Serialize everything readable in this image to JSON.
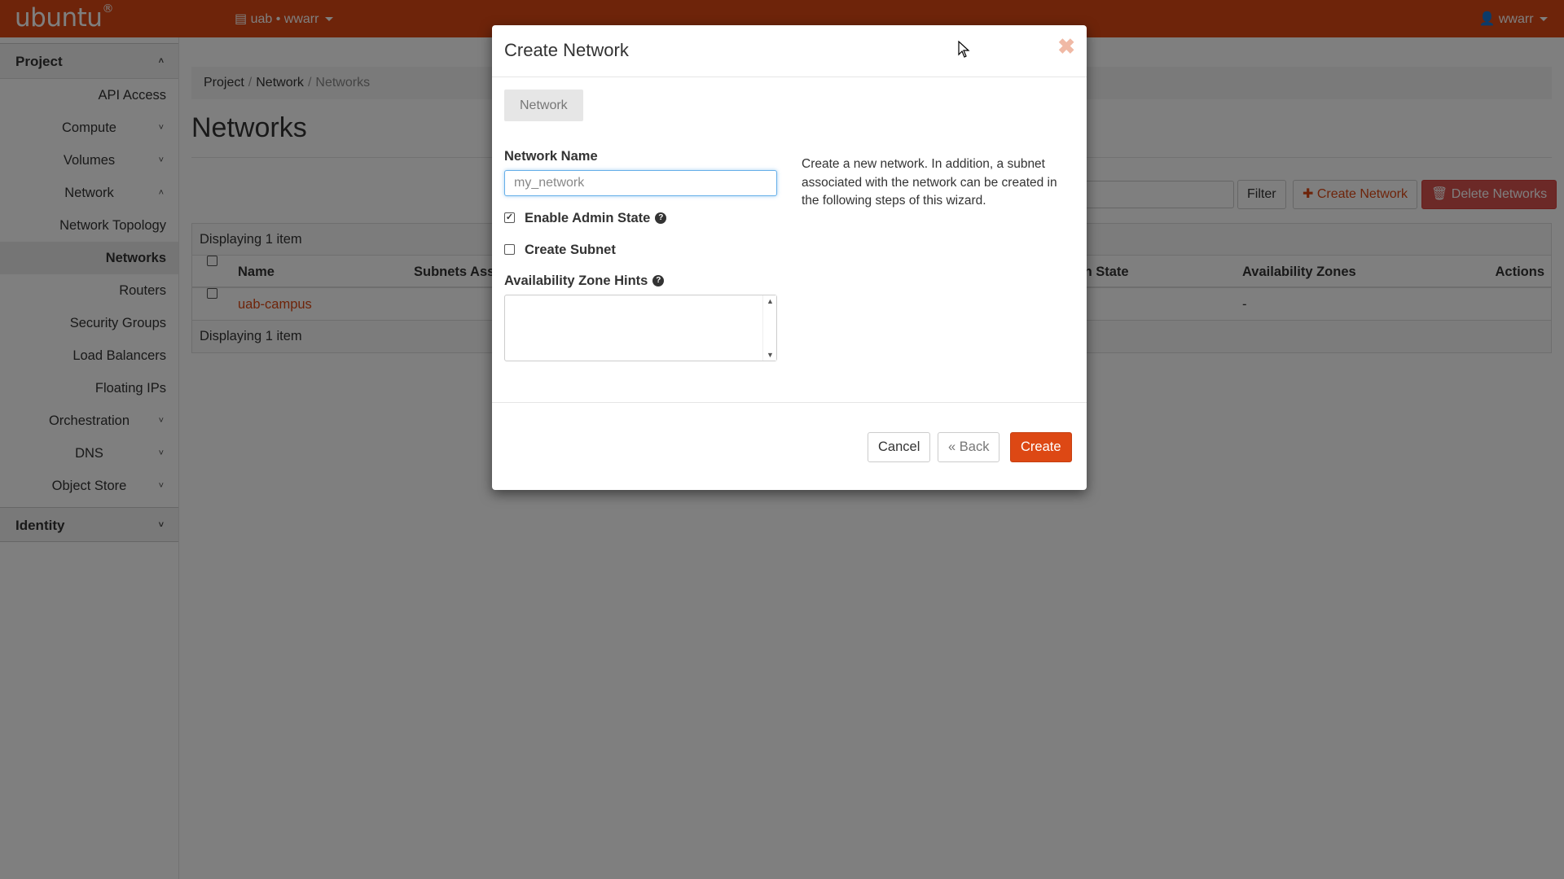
{
  "navbar": {
    "brand": "ubuntu",
    "brand_mark": "®",
    "project_switch": "uab • wwarr",
    "user": "wwarr"
  },
  "sidebar": {
    "project_label": "Project",
    "items": [
      {
        "label": "API Access"
      },
      {
        "label": "Compute"
      },
      {
        "label": "Volumes"
      },
      {
        "label": "Network"
      },
      {
        "label": "Network Topology"
      },
      {
        "label": "Networks"
      },
      {
        "label": "Routers"
      },
      {
        "label": "Security Groups"
      },
      {
        "label": "Load Balancers"
      },
      {
        "label": "Floating IPs"
      },
      {
        "label": "Orchestration"
      },
      {
        "label": "DNS"
      },
      {
        "label": "Object Store"
      }
    ],
    "identity_label": "Identity"
  },
  "breadcrumb": {
    "items": [
      "Project",
      "Network",
      "Networks"
    ]
  },
  "page": {
    "title": "Networks",
    "filter_button": "Filter",
    "create_button": "Create Network",
    "delete_button": "Delete Networks"
  },
  "table": {
    "caption": "Displaying 1 item",
    "footer": "Displaying 1 item",
    "columns": [
      "Name",
      "Subnets Ass",
      "in State",
      "Availability Zones",
      "Actions"
    ],
    "rows": [
      {
        "name": "uab-campus",
        "availability_zones": "-"
      }
    ]
  },
  "modal": {
    "title": "Create Network",
    "close_glyph": "✖",
    "tab": "Network",
    "network_name_label": "Network Name",
    "network_name_placeholder": "my_network",
    "enable_admin_state_label": "Enable Admin State",
    "enable_admin_state_checked": true,
    "create_subnet_label": "Create Subnet",
    "create_subnet_checked": false,
    "az_hints_label": "Availability Zone Hints",
    "help_text": "Create a new network. In addition, a subnet associated with the network can be created in the following steps of this wizard.",
    "cancel_button": "Cancel",
    "back_button": "« Back",
    "create_button": "Create"
  },
  "colors": {
    "brand": "#dd4814",
    "danger": "#d9534f",
    "focus": "#66afe9"
  }
}
